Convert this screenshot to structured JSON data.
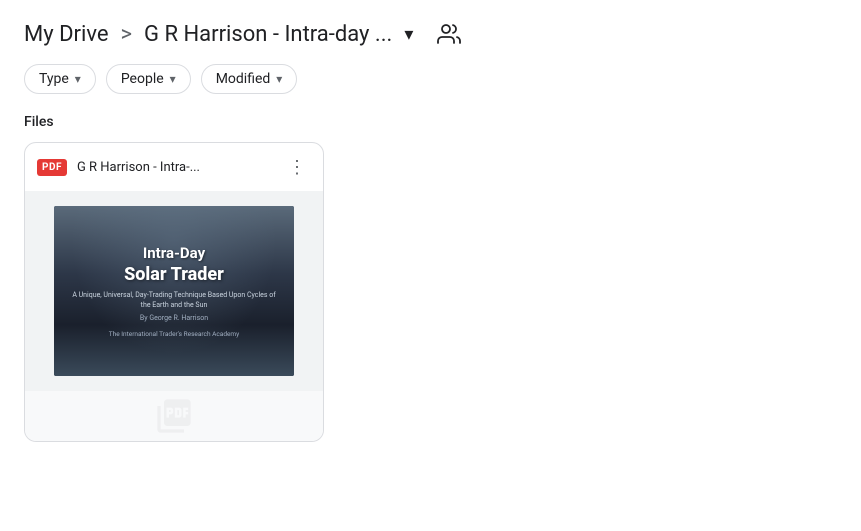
{
  "breadcrumb": {
    "my_drive_label": "My Drive",
    "separator": ">",
    "folder_name": "G R Harrison - Intra-day ...",
    "dropdown_icon": "▾"
  },
  "share_icon": "👤",
  "filters": {
    "type_label": "Type",
    "people_label": "People",
    "modified_label": "Modified",
    "chevron": "▾"
  },
  "files_section": {
    "label": "Files"
  },
  "file_card": {
    "pdf_badge": "PDF",
    "file_name": "G R Harrison - Intra-...",
    "more_options_icon": "⋮",
    "book_title_line1": "Intra-Day",
    "book_title_line2": "Solar Trader",
    "book_subtitle": "A Unique, Universal, Day-Trading Technique\nBased Upon Cycles of the Earth and the Sun",
    "book_author": "By George R. Harrison",
    "book_publisher": "The International Trader's Research Academy"
  }
}
